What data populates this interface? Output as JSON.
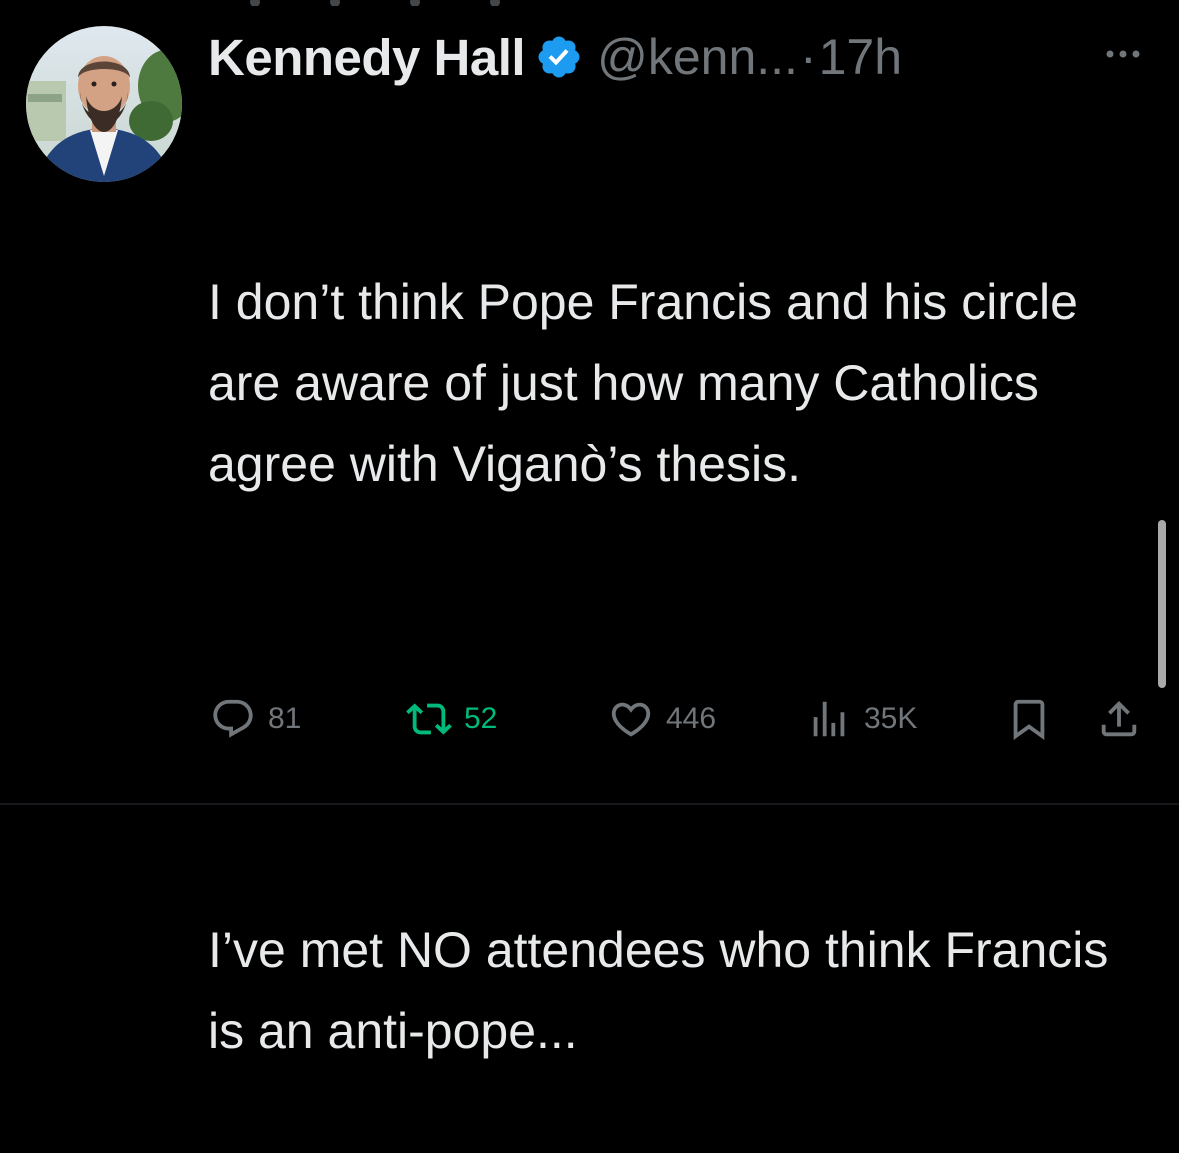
{
  "tweet": {
    "author": {
      "display_name": "Kennedy Hall",
      "handle": "@kenn...",
      "verified": true,
      "avatar_icon": "profile-photo"
    },
    "separator": "·",
    "timestamp": "17h",
    "more_icon": "more-horizontal-icon",
    "text_paragraphs": [
      "I don’t think Pope Francis and his circle are aware of just how many Catholics agree with Viganò’s thesis.",
      "I’ve met NO attendees who think Francis is an anti-pope..."
    ],
    "actions": {
      "replies": {
        "icon": "reply-icon",
        "count": "81"
      },
      "retweets": {
        "icon": "retweet-icon",
        "count": "52",
        "active": true
      },
      "likes": {
        "icon": "heart-icon",
        "count": "446"
      },
      "views": {
        "icon": "views-icon",
        "count": "35K"
      },
      "bookmark": {
        "icon": "bookmark-icon"
      },
      "share": {
        "icon": "share-icon"
      }
    }
  },
  "colors": {
    "background": "#000000",
    "text_primary": "#e7e9ea",
    "text_secondary": "#71767b",
    "verified_blue": "#1d9bf0",
    "retweet_green": "#00ba7c"
  }
}
